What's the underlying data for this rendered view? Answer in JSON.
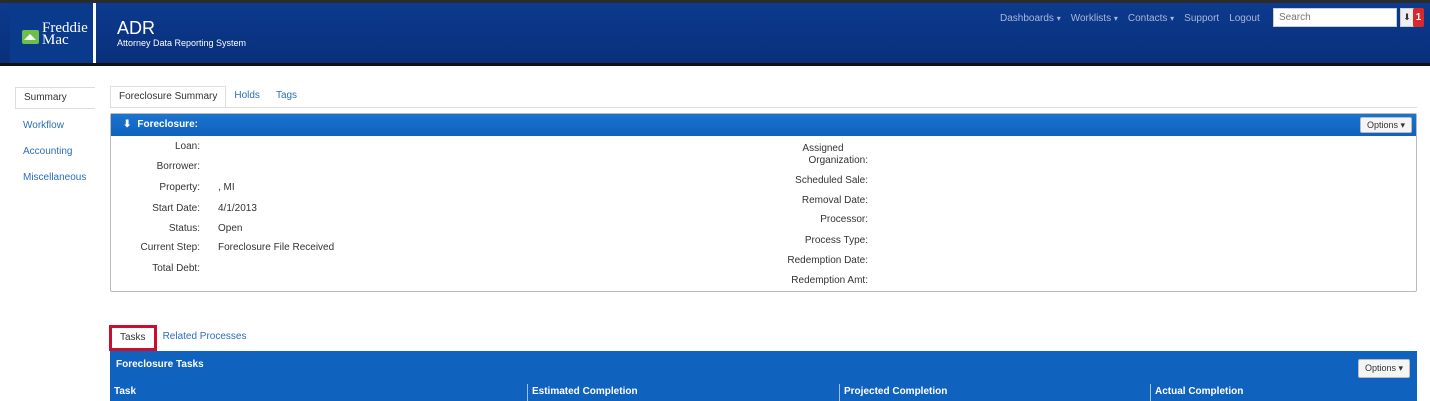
{
  "header": {
    "logo_line1": "Freddie",
    "logo_line2": "Mac",
    "title": "ADR",
    "subtitle": "Attorney Data Reporting System",
    "nav": [
      {
        "label": "Dashboards",
        "caret": "▾"
      },
      {
        "label": "Worklists",
        "caret": "▾"
      },
      {
        "label": "Contacts",
        "caret": "▾"
      },
      {
        "label": "Support",
        "caret": ""
      },
      {
        "label": "Logout",
        "caret": ""
      }
    ],
    "search_placeholder": "Search",
    "search_button": "⬇",
    "notification_count": "1"
  },
  "sidebar": {
    "items": [
      {
        "label": "Summary",
        "active": true
      },
      {
        "label": "Workflow"
      },
      {
        "label": "Accounting"
      },
      {
        "label": "Miscellaneous"
      }
    ]
  },
  "top_tabs": [
    {
      "label": "Foreclosure Summary",
      "active": true
    },
    {
      "label": "Holds"
    },
    {
      "label": "Tags"
    }
  ],
  "foreclosure": {
    "title": "Foreclosure:",
    "options_label": "Options",
    "left_fields": [
      {
        "label": "Loan:",
        "value": ""
      },
      {
        "label": "Borrower:",
        "value": ""
      },
      {
        "label": "Property:",
        "value": ", MI"
      },
      {
        "label": "Start Date:",
        "value": "4/1/2013"
      },
      {
        "label": "Status:",
        "value": "Open"
      },
      {
        "label": "Current Step:",
        "value": "Foreclosure File Received"
      },
      {
        "label": "Total Debt:",
        "value": ""
      }
    ],
    "right_fields": [
      {
        "label_line1": "Assigned",
        "label_line2": "Organization:"
      },
      {
        "label_line1": "Scheduled Sale:"
      },
      {
        "label_line1": "Removal Date:"
      },
      {
        "label_line1": "Processor:"
      },
      {
        "label_line1": "Process Type:"
      },
      {
        "label_line1": "Redemption Date:"
      },
      {
        "label_line1": "Redemption Amt:"
      }
    ]
  },
  "bottom_tabs": [
    {
      "label": "Tasks",
      "active": true
    },
    {
      "label": "Related Processes"
    }
  ],
  "tasks": {
    "title": "Foreclosure Tasks",
    "options_label": "Options",
    "columns": [
      "Task",
      "Estimated Completion",
      "Projected Completion",
      "Actual Completion"
    ]
  }
}
